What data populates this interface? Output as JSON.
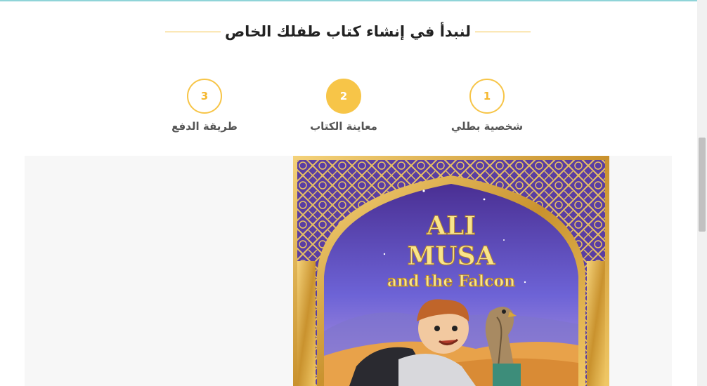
{
  "header": {
    "title": "لنبدأ في إنشاء كتاب طفلك الخاص"
  },
  "steps": [
    {
      "number": "1",
      "label": "شخصية بطلي",
      "active": false
    },
    {
      "number": "2",
      "label": "معاينة الكتاب",
      "active": true
    },
    {
      "number": "3",
      "label": "طريقة الدفع",
      "active": false
    }
  ],
  "book": {
    "title_line1": "ALI",
    "title_line2": "MUSA",
    "subtitle": "and the Falcon"
  },
  "colors": {
    "accent": "#f7c548",
    "accent_text": "#f5b830",
    "book_frame_gold": "#d9a738",
    "book_sky": "#6b5cc9",
    "book_purple_top": "#5b3fa0",
    "sand": "#e8a24a"
  }
}
